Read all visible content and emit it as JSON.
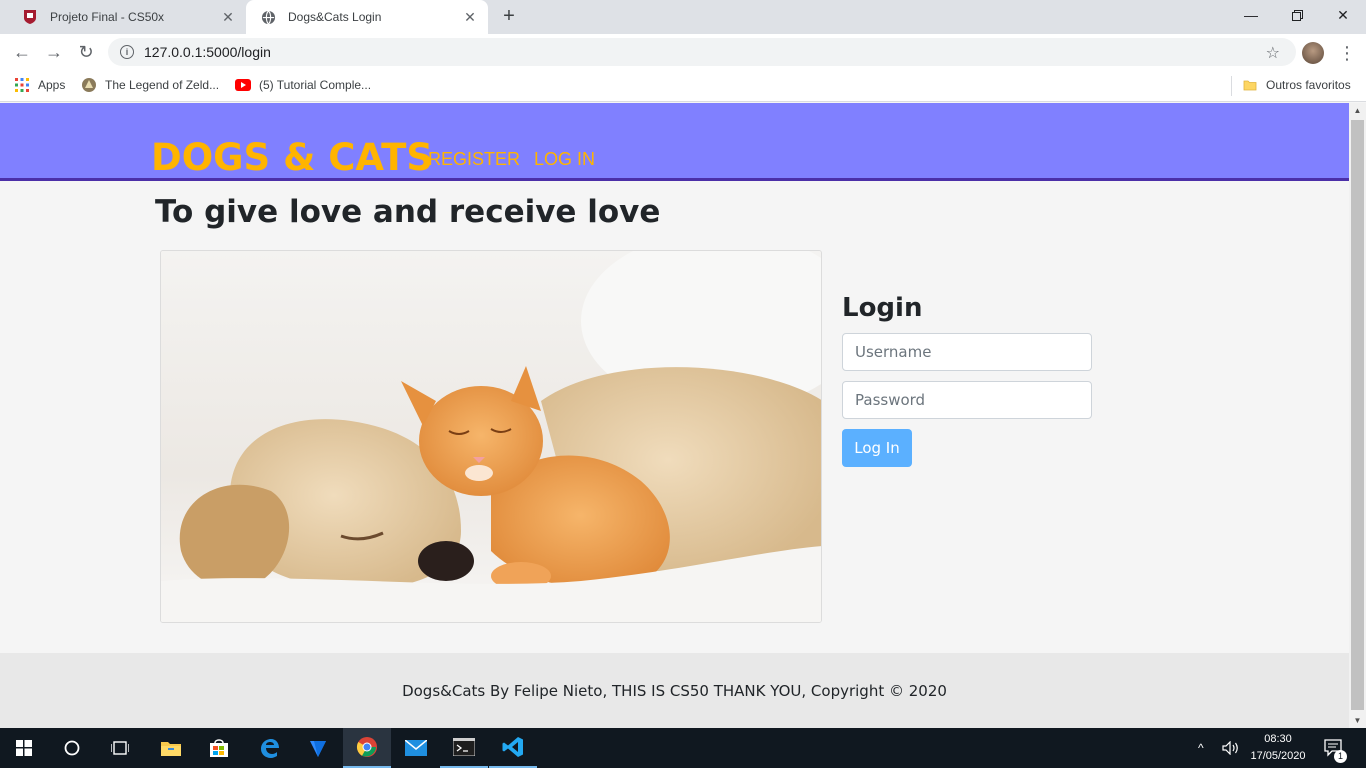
{
  "browser": {
    "tabs": [
      {
        "title": "Projeto Final - CS50x",
        "active": false
      },
      {
        "title": "Dogs&Cats Login",
        "active": true
      }
    ],
    "new_tab_symbol": "+",
    "url": "127.0.0.1:5000/login",
    "bookmarks": [
      {
        "label": "Apps",
        "icon": "apps-grid-icon"
      },
      {
        "label": "The Legend of Zeld...",
        "icon": "zelda-favicon"
      },
      {
        "label": "(5) Tutorial Comple...",
        "icon": "youtube-icon"
      }
    ],
    "other_bookmarks": "Outros favoritos"
  },
  "site": {
    "brand": "DOGS & CATS",
    "nav_links": [
      "REGISTER",
      "LOG IN"
    ],
    "heading": "To give love and receive love",
    "login": {
      "title": "Login",
      "username_placeholder": "Username",
      "password_placeholder": "Password",
      "button_label": "Log In"
    },
    "footer": "Dogs&Cats By Felipe Nieto, THIS IS CS50 THANK YOU, Copyright © 2020"
  },
  "colors": {
    "navbar": "#8080ff",
    "brand": "#ffb400",
    "navbar_border": "#4b2fa8",
    "login_button": "#5bb0ff"
  },
  "taskbar": {
    "apps": [
      "windows-start-icon",
      "cortana-search-icon",
      "task-view-icon",
      "file-explorer-icon",
      "store-icon",
      "edge-icon",
      "azure-icon",
      "chrome-icon",
      "mail-icon",
      "terminal-icon",
      "vscode-icon"
    ],
    "time": "08:30",
    "date": "17/05/2020",
    "notification_count": "1"
  }
}
